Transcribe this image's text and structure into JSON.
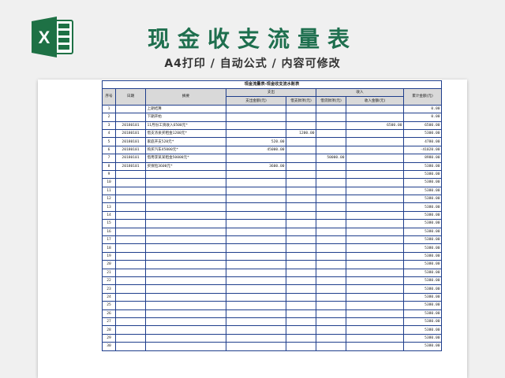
{
  "header": {
    "title": "现金收支流量表",
    "subtitle": "A4打印 / 自动公式 / 内容可修改",
    "logo_letter": "X",
    "logo_color": "#1e7145"
  },
  "table": {
    "caption": "现金流量表-现金收支流水账表",
    "col_headers": {
      "index": "序号",
      "date": "日期",
      "summary": "摘要",
      "expense_group": "支出",
      "expense_amount": "支出金额(元)",
      "loan_amount": "借支款项(元)",
      "income_group": "收入",
      "repay_amount": "借贷款项(元)",
      "income_amount": "收入金额(元)",
      "balance": "累计金额(元)"
    },
    "rows": [
      {
        "idx": "1",
        "date": "",
        "summary": "上期结算",
        "exp": "",
        "loan": "",
        "repay": "",
        "inc": "",
        "bal": "0.00"
      },
      {
        "idx": "2",
        "date": "",
        "summary": "下期开始",
        "exp": "",
        "loan": "",
        "repay": "",
        "inc": "",
        "bal": "0.00"
      },
      {
        "idx": "3",
        "date": "20180101",
        "summary": "11月份工资收入6500元*",
        "exp": "",
        "loan": "",
        "repay": "",
        "inc": "6500.00",
        "bal": "6500.00"
      },
      {
        "idx": "4",
        "date": "20180101",
        "summary": "借支浓泉买租金1200元*",
        "exp": "",
        "loan": "1200.00",
        "repay": "",
        "inc": "",
        "bal": "5300.00"
      },
      {
        "idx": "5",
        "date": "20180101",
        "summary": "家庭开支520元*",
        "exp": "520.00",
        "loan": "",
        "repay": "",
        "inc": "",
        "bal": "4780.00"
      },
      {
        "idx": "6",
        "date": "20180101",
        "summary": "购买汽车45000元*",
        "exp": "45000.00",
        "loan": "",
        "repay": "",
        "inc": "",
        "bal": "-41020.00"
      },
      {
        "idx": "7",
        "date": "20180101",
        "summary": "借用李某某租金50000元*",
        "exp": "",
        "loan": "",
        "repay": "50000.00",
        "inc": "",
        "bal": "8980.00"
      },
      {
        "idx": "8",
        "date": "20180101",
        "summary": "买保险3600元*",
        "exp": "3600.00",
        "loan": "",
        "repay": "",
        "inc": "",
        "bal": "5380.00"
      },
      {
        "idx": "9",
        "date": "",
        "summary": "",
        "exp": "",
        "loan": "",
        "repay": "",
        "inc": "",
        "bal": "5380.00"
      },
      {
        "idx": "10",
        "date": "",
        "summary": "",
        "exp": "",
        "loan": "",
        "repay": "",
        "inc": "",
        "bal": "5380.00"
      },
      {
        "idx": "11",
        "date": "",
        "summary": "",
        "exp": "",
        "loan": "",
        "repay": "",
        "inc": "",
        "bal": "5380.00"
      },
      {
        "idx": "12",
        "date": "",
        "summary": "",
        "exp": "",
        "loan": "",
        "repay": "",
        "inc": "",
        "bal": "5380.00"
      },
      {
        "idx": "13",
        "date": "",
        "summary": "",
        "exp": "",
        "loan": "",
        "repay": "",
        "inc": "",
        "bal": "5380.00"
      },
      {
        "idx": "14",
        "date": "",
        "summary": "",
        "exp": "",
        "loan": "",
        "repay": "",
        "inc": "",
        "bal": "5380.00"
      },
      {
        "idx": "15",
        "date": "",
        "summary": "",
        "exp": "",
        "loan": "",
        "repay": "",
        "inc": "",
        "bal": "5380.00"
      },
      {
        "idx": "16",
        "date": "",
        "summary": "",
        "exp": "",
        "loan": "",
        "repay": "",
        "inc": "",
        "bal": "5380.00"
      },
      {
        "idx": "17",
        "date": "",
        "summary": "",
        "exp": "",
        "loan": "",
        "repay": "",
        "inc": "",
        "bal": "5380.00"
      },
      {
        "idx": "18",
        "date": "",
        "summary": "",
        "exp": "",
        "loan": "",
        "repay": "",
        "inc": "",
        "bal": "5380.00"
      },
      {
        "idx": "19",
        "date": "",
        "summary": "",
        "exp": "",
        "loan": "",
        "repay": "",
        "inc": "",
        "bal": "5380.00"
      },
      {
        "idx": "20",
        "date": "",
        "summary": "",
        "exp": "",
        "loan": "",
        "repay": "",
        "inc": "",
        "bal": "5380.00"
      },
      {
        "idx": "21",
        "date": "",
        "summary": "",
        "exp": "",
        "loan": "",
        "repay": "",
        "inc": "",
        "bal": "5380.00"
      },
      {
        "idx": "22",
        "date": "",
        "summary": "",
        "exp": "",
        "loan": "",
        "repay": "",
        "inc": "",
        "bal": "5380.00"
      },
      {
        "idx": "23",
        "date": "",
        "summary": "",
        "exp": "",
        "loan": "",
        "repay": "",
        "inc": "",
        "bal": "5380.00"
      },
      {
        "idx": "24",
        "date": "",
        "summary": "",
        "exp": "",
        "loan": "",
        "repay": "",
        "inc": "",
        "bal": "5380.00"
      },
      {
        "idx": "25",
        "date": "",
        "summary": "",
        "exp": "",
        "loan": "",
        "repay": "",
        "inc": "",
        "bal": "5380.00"
      },
      {
        "idx": "26",
        "date": "",
        "summary": "",
        "exp": "",
        "loan": "",
        "repay": "",
        "inc": "",
        "bal": "5380.00"
      },
      {
        "idx": "27",
        "date": "",
        "summary": "",
        "exp": "",
        "loan": "",
        "repay": "",
        "inc": "",
        "bal": "5380.00"
      },
      {
        "idx": "28",
        "date": "",
        "summary": "",
        "exp": "",
        "loan": "",
        "repay": "",
        "inc": "",
        "bal": "5380.00"
      },
      {
        "idx": "29",
        "date": "",
        "summary": "",
        "exp": "",
        "loan": "",
        "repay": "",
        "inc": "",
        "bal": "5380.00"
      },
      {
        "idx": "30",
        "date": "",
        "summary": "",
        "exp": "",
        "loan": "",
        "repay": "",
        "inc": "",
        "bal": "5380.00"
      }
    ]
  }
}
